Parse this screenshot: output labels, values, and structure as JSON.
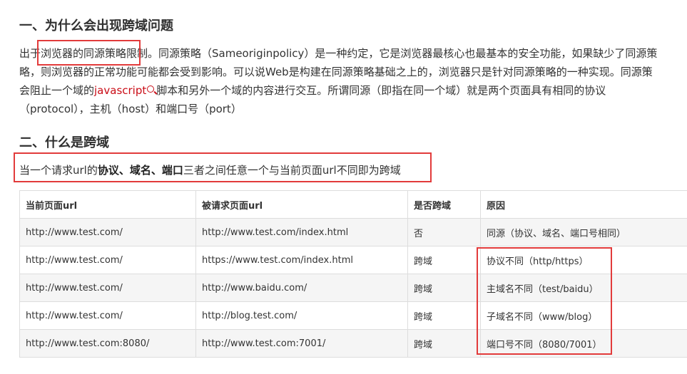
{
  "section1": {
    "heading": "一、为什么会出现跨域问题",
    "line1": "出于浏览器的同源策略限制。同源策略（Sameoriginpolicy）是一种约定，它是浏览器最核心也最基本的安全功能，如果缺少了同源策",
    "line2": "略，则浏览器的正常功能可能都会受到影响。可以说Web是构建在同源策略基础之上的，浏览器只是针对同源策略的一种实现。同源策",
    "line3_pre": "会阻止一个域的",
    "line3_link": "javascript",
    "line3_post": "脚本和另外一个域的内容进行交互。所谓同源（即指在同一个域）就是两个页面具有相同的协议",
    "line4": "（protocol），主机（host）和端口号（port）"
  },
  "section2": {
    "heading": "二、什么是跨域",
    "def_pre": "当一个请求url的",
    "def_bold": "协议、域名、端口",
    "def_post": "三者之间任意一个与当前页面url不同即为跨域"
  },
  "table": {
    "headers": [
      "当前页面url",
      "被请求页面url",
      "是否跨域",
      "原因"
    ],
    "rows": [
      [
        "http://www.test.com/",
        "http://www.test.com/index.html",
        "否",
        "同源（协议、域名、端口号相同）"
      ],
      [
        "http://www.test.com/",
        "https://www.test.com/index.html",
        "跨域",
        "协议不同（http/https）"
      ],
      [
        "http://www.test.com/",
        "http://www.baidu.com/",
        "跨域",
        "主域名不同（test/baidu）"
      ],
      [
        "http://www.test.com/",
        "http://blog.test.com/",
        "跨域",
        "子域名不同（www/blog）"
      ],
      [
        "http://www.test.com:8080/",
        "http://www.test.com:7001/",
        "跨域",
        "端口号不同（8080/7001）"
      ]
    ]
  },
  "colors": {
    "highlight": "#e23b3b",
    "link": "#ca0c16",
    "text": "#333333"
  },
  "icons": {
    "link_icon": "search-icon"
  }
}
